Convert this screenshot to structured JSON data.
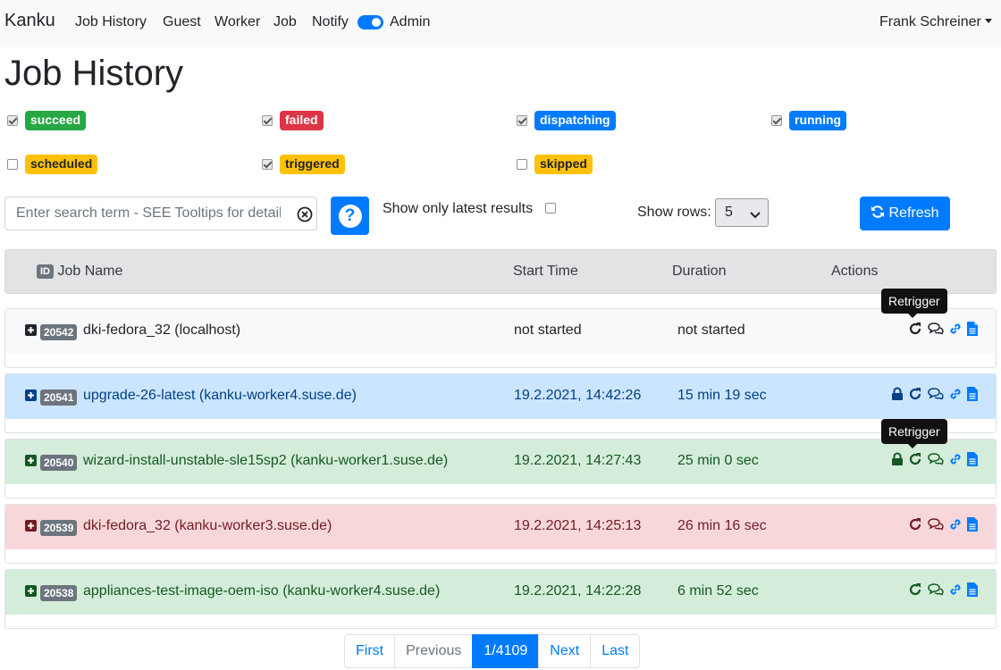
{
  "navbar": {
    "brand": "Kanku",
    "items": [
      "Job History",
      "Guest",
      "Worker",
      "Job",
      "Notify"
    ],
    "admin_label": "Admin",
    "admin_enabled": true,
    "user": "Frank Schreiner"
  },
  "page_title": "Job History",
  "filters": [
    {
      "label": "succeed",
      "checked": true,
      "color": "#28a745"
    },
    {
      "label": "failed",
      "checked": true,
      "color": "#dc3545"
    },
    {
      "label": "dispatching",
      "checked": true,
      "color": "#007bff"
    },
    {
      "label": "running",
      "checked": true,
      "color": "#007bff"
    },
    {
      "label": "scheduled",
      "checked": false,
      "color": "#ffc107"
    },
    {
      "label": "triggered",
      "checked": true,
      "color": "#ffc107"
    },
    {
      "label": "skipped",
      "checked": false,
      "color": "#ffc107"
    }
  ],
  "search": {
    "placeholder": "Enter search term - SEE Tooltips for details",
    "value": ""
  },
  "help_label": "?",
  "latest_results": {
    "label": "Show only latest results",
    "checked": false
  },
  "rows": {
    "label": "Show rows:",
    "value": "5"
  },
  "refresh_label": "Refresh",
  "table": {
    "id_badge": "ID",
    "columns": [
      "Job Name",
      "Start Time",
      "Duration",
      "Actions"
    ]
  },
  "jobs": [
    {
      "id": "20542",
      "name": "dki-fedora_32 (localhost)",
      "start": "not started",
      "duration": "not started",
      "state": "scheduled",
      "locked": false
    },
    {
      "id": "20541",
      "name": "upgrade-26-latest (kanku-worker4.suse.de)",
      "start": "19.2.2021, 14:42:26",
      "duration": "15 min 19 sec",
      "state": "running",
      "locked": true
    },
    {
      "id": "20540",
      "name": "wizard-install-unstable-sle15sp2 (kanku-worker1.suse.de)",
      "start": "19.2.2021, 14:27:43",
      "duration": "25 min 0 sec",
      "state": "succeed",
      "locked": true
    },
    {
      "id": "20539",
      "name": "dki-fedora_32 (kanku-worker3.suse.de)",
      "start": "19.2.2021, 14:25:13",
      "duration": "26 min 16 sec",
      "state": "failed",
      "locked": false
    },
    {
      "id": "20538",
      "name": "appliances-test-image-oem-iso (kanku-worker4.suse.de)",
      "start": "19.2.2021, 14:22:28",
      "duration": "6 min 52 sec",
      "state": "succeed",
      "locked": false
    }
  ],
  "tooltips": [
    "Retrigger",
    "Retrigger"
  ],
  "pagination": {
    "first": "First",
    "previous": "Previous",
    "current": "1/4109",
    "next": "Next",
    "last": "Last"
  },
  "colors": {
    "primary": "#007bff",
    "row_running_bg": "#cce5ff",
    "row_running_fg": "#004085",
    "row_succeed_bg": "#d4edda",
    "row_succeed_fg": "#155724",
    "row_failed_bg": "#f8d7da",
    "row_failed_fg": "#721c24",
    "row_scheduled_bg": "#f8f9fa"
  }
}
